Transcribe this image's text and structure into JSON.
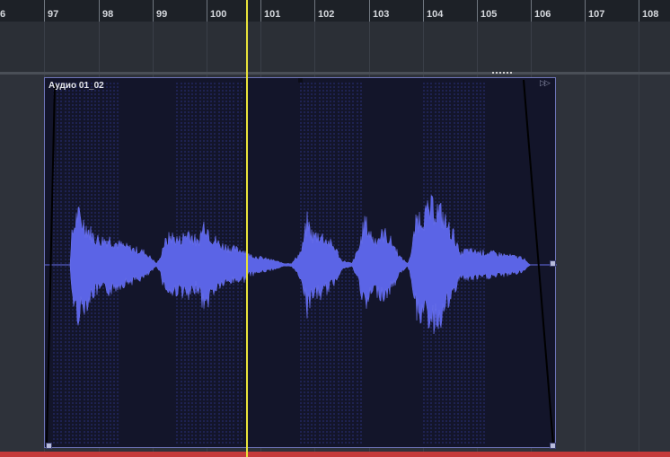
{
  "ruler": {
    "labels": [
      "6",
      "97",
      "98",
      "99",
      "100",
      "101",
      "102",
      "103",
      "104",
      "105",
      "106",
      "107",
      "108"
    ]
  },
  "event": {
    "name": "Аудио 01_02"
  },
  "colors": {
    "cursor": "#e8e23a",
    "waveform": "#5b64e6",
    "event_bg": "#13152a",
    "bottom_bar": "#c43a3a"
  }
}
